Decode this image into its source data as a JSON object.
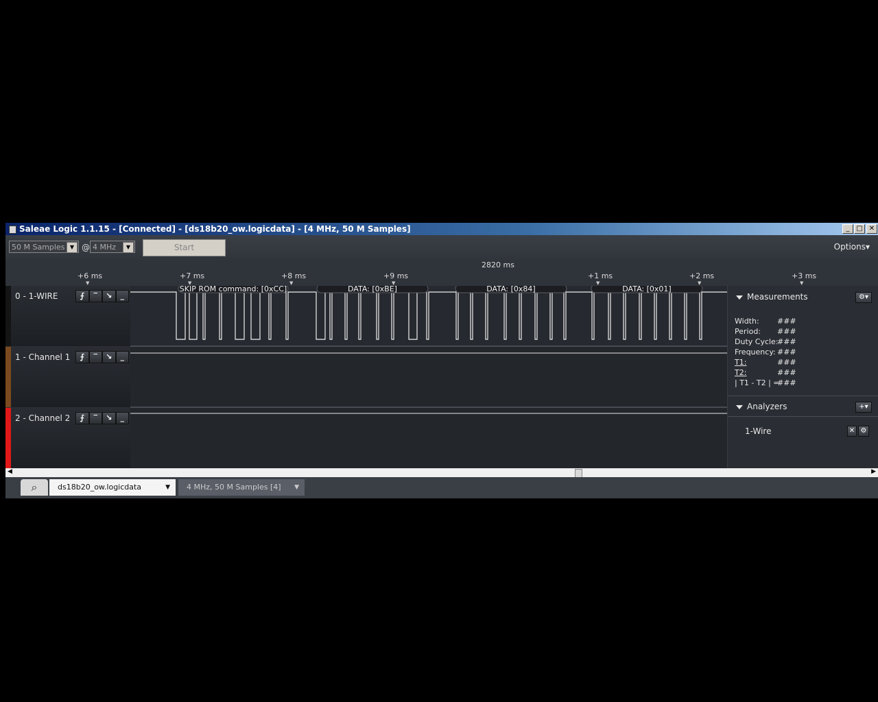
{
  "window": {
    "title": "Saleae Logic 1.1.15 - [Connected] - [ds18b20_ow.logicdata] - [4 MHz, 50 M Samples]"
  },
  "caption_buttons": {
    "minimize": "_",
    "maximize": "□",
    "close": "✕"
  },
  "toolbar": {
    "samples": "50 M Samples",
    "at": "@",
    "rate": "4 MHz",
    "start": "Start",
    "options": "Options▾"
  },
  "ruler": {
    "center_time": "2820 ms",
    "ticks": [
      "+6 ms",
      "+7 ms",
      "+8 ms",
      "+9 ms",
      "+1 ms",
      "+2 ms",
      "+3 ms"
    ]
  },
  "channels": [
    {
      "name": "0 - 1-WIRE",
      "color": "#141414"
    },
    {
      "name": "1 - Channel 1",
      "color": "#7a4a1e"
    },
    {
      "name": "2 - Channel 2",
      "color": "#e01818"
    }
  ],
  "trigger_glyphs": [
    "⨍",
    "‾",
    "↘",
    "_"
  ],
  "decodes": [
    {
      "label": "SKIP ROM command: [0xCC]"
    },
    {
      "label": "DATA: [0xBE]"
    },
    {
      "label": "DATA: [0x84]"
    },
    {
      "label": "DATA: [0x01]"
    }
  ],
  "measurements": {
    "title": "Measurements",
    "rows": [
      {
        "label": "Width:",
        "value": "###"
      },
      {
        "label": "Period:",
        "value": "###"
      },
      {
        "label": "Duty Cycle:",
        "value": "###"
      },
      {
        "label": "Frequency:",
        "value": "###"
      },
      {
        "label": "T1:",
        "value": "###"
      },
      {
        "label": "T2:",
        "value": "###"
      },
      {
        "label": "| T1 - T2 | =",
        "value": "###"
      }
    ]
  },
  "analyzers": {
    "title": "Analyzers",
    "items": [
      "1-Wire"
    ]
  },
  "tabs": {
    "file": "ds18b20_ow.logicdata",
    "capture": "4 MHz, 50 M Samples [4]"
  }
}
